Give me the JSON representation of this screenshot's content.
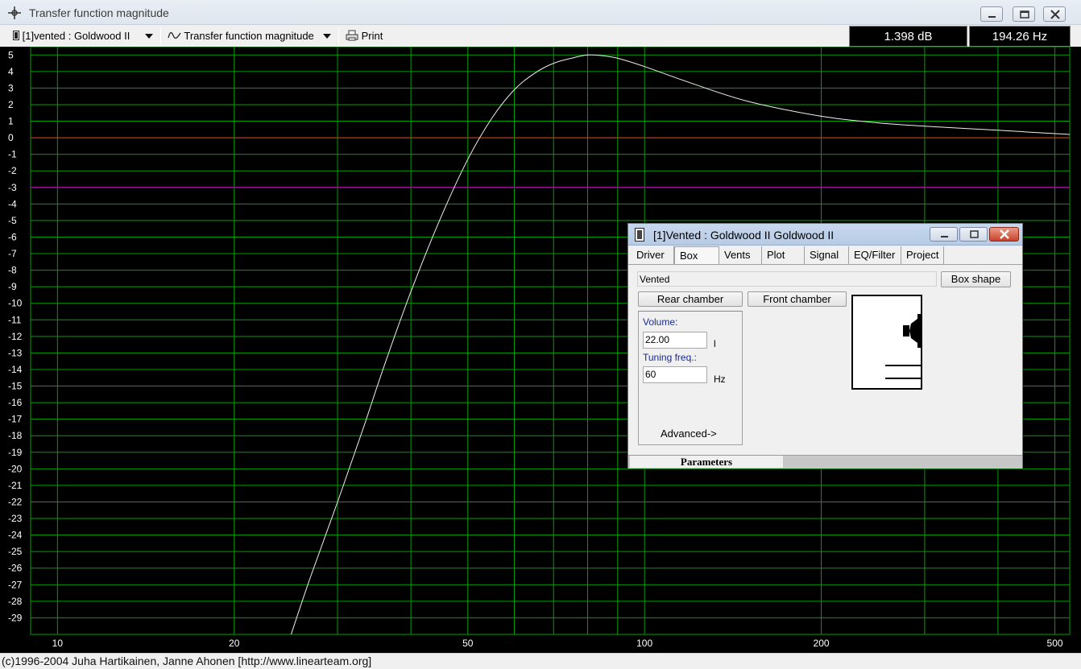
{
  "window": {
    "title": "Transfer function magnitude",
    "buttons": [
      "minimize-icon",
      "maximize-icon",
      "close-icon"
    ]
  },
  "toolbar": {
    "project_selector": "[1]vented : Goldwood II",
    "plot_selector": "Transfer function magnitude",
    "print_label": "Print"
  },
  "readouts": {
    "level": "1.398 dB",
    "frequency": "194.26 Hz"
  },
  "status_bar": "(c)1996-2004 Juha Hartikainen, Janne Ahonen [http://www.linearteam.org]",
  "colors": {
    "plot_background": "#000000",
    "grid": "#00a000",
    "curve": "#f0f0f0",
    "zero_line": "#ff2020",
    "minus3_line": "#c000c0"
  },
  "chart_data": {
    "type": "line",
    "title": "Transfer function magnitude",
    "xlabel": "",
    "ylabel": "",
    "x_scale": "log",
    "xlim": [
      9,
      530
    ],
    "ylim": [
      -30,
      5.5
    ],
    "grid": true,
    "x_tick_labels": [
      {
        "value": 10,
        "label": "10"
      },
      {
        "value": 20,
        "label": "20"
      },
      {
        "value": 50,
        "label": "50"
      },
      {
        "value": 100,
        "label": "100"
      },
      {
        "value": 200,
        "label": "200"
      },
      {
        "value": 500,
        "label": "500"
      }
    ],
    "y_tick_labels": [
      "5",
      "4",
      "3",
      "2",
      "1",
      "0",
      "-1",
      "-2",
      "-3",
      "-4",
      "-5",
      "-6",
      "-7",
      "-8",
      "-9",
      "-10",
      "-11",
      "-12",
      "-13",
      "-14",
      "-15",
      "-16",
      "-17",
      "-18",
      "-19",
      "-20",
      "-21",
      "-22",
      "-23",
      "-24",
      "-25",
      "-26",
      "-27",
      "-28",
      "-29"
    ],
    "reference_lines": [
      {
        "y": 0,
        "color": "#ff2020"
      },
      {
        "y": -3,
        "color": "#c000c0"
      }
    ],
    "series": [
      {
        "x": [
          25,
          27,
          30,
          33,
          36,
          40,
          45,
          50,
          55,
          60,
          65,
          70,
          75,
          80,
          85,
          90,
          100,
          120,
          150,
          200,
          250,
          300,
          400,
          530
        ],
        "y": [
          -30,
          -26.5,
          -22,
          -17.8,
          -13.8,
          -9.3,
          -4.8,
          -1.3,
          1.2,
          2.9,
          3.9,
          4.5,
          4.8,
          5.0,
          4.95,
          4.8,
          4.3,
          3.3,
          2.2,
          1.3,
          0.9,
          0.7,
          0.45,
          0.2
        ]
      }
    ]
  },
  "dialog": {
    "title": "[1]Vented : Goldwood II Goldwood II",
    "tabs": [
      "Driver",
      "Box",
      "Vents",
      "Plot",
      "Signal",
      "EQ/Filter",
      "Project"
    ],
    "active_tab": "Box",
    "box_type": "Vented",
    "box_shape_button": "Box shape",
    "rear_chamber_button": "Rear chamber",
    "front_chamber_button": "Front chamber",
    "volume_label": "Volume:",
    "volume_value": "22.00",
    "volume_unit": "l",
    "tuning_label": "Tuning freq.:",
    "tuning_value": "60",
    "tuning_unit": "Hz",
    "advanced_button": "Advanced->",
    "parameters_tab": "Parameters"
  }
}
